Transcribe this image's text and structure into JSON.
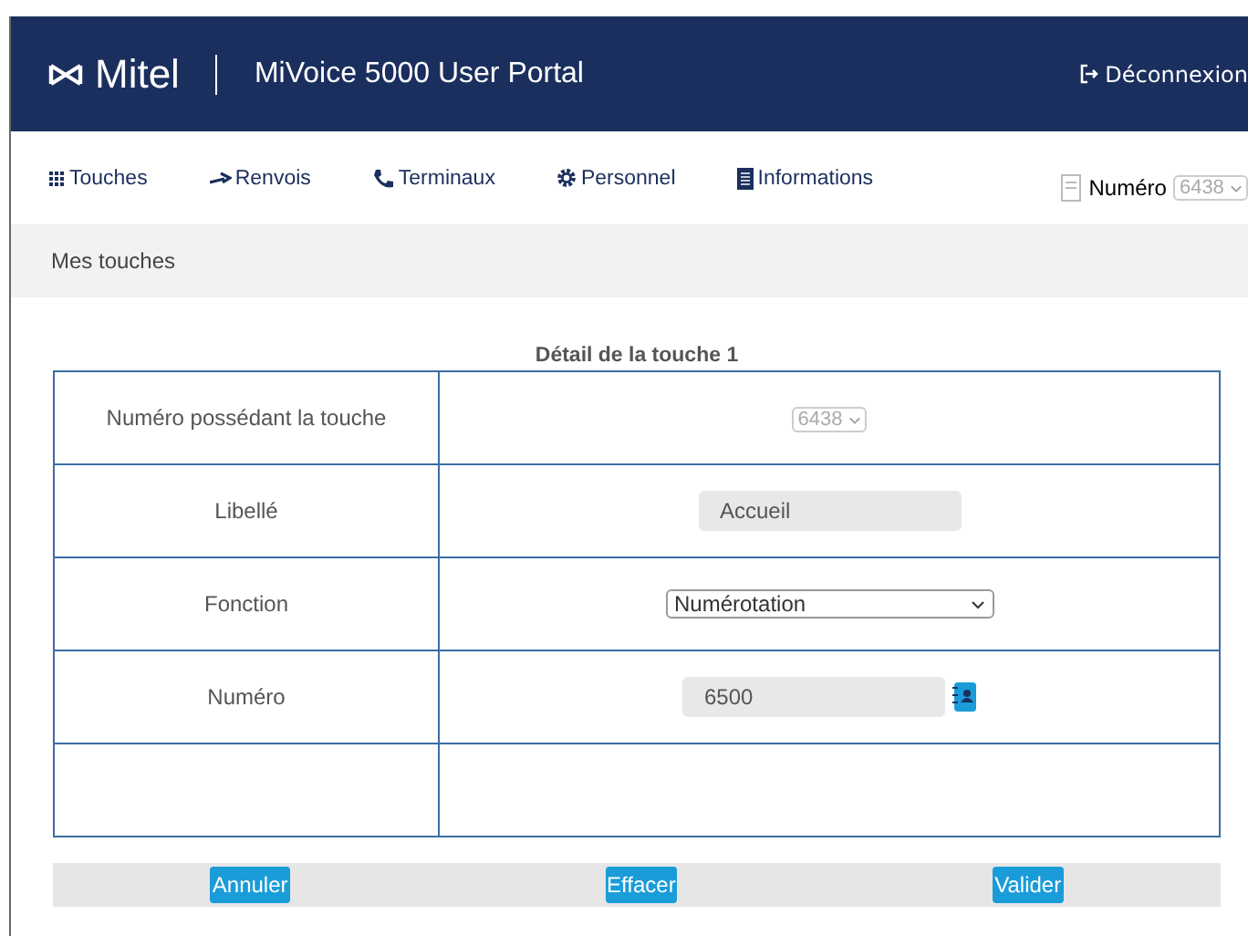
{
  "header": {
    "logo": "Mitel",
    "title": "MiVoice 5000 User Portal",
    "logout": "Déconnexion"
  },
  "nav": [
    {
      "label": "Touches"
    },
    {
      "label": "Renvois"
    },
    {
      "label": "Terminaux"
    },
    {
      "label": "Personnel"
    },
    {
      "label": "Informations"
    }
  ],
  "number_selector": {
    "label": "Numéro",
    "value": "6438",
    "disabled": true
  },
  "breadcrumb": "Mes touches",
  "detail": {
    "title": "Détail de la touche 1",
    "rows": [
      {
        "kind": "select",
        "label": "Numéro possédant la touche",
        "value": "6438",
        "disabled": true
      },
      {
        "kind": "text",
        "label": "Libellé",
        "value": "Accueil"
      },
      {
        "kind": "dropdown",
        "label": "Fonction",
        "value": "Numérotation"
      },
      {
        "kind": "number",
        "label": "Numéro",
        "value": "6500"
      },
      {
        "kind": "empty"
      }
    ]
  },
  "buttons": [
    "Annuler",
    "Effacer",
    "Valider"
  ]
}
